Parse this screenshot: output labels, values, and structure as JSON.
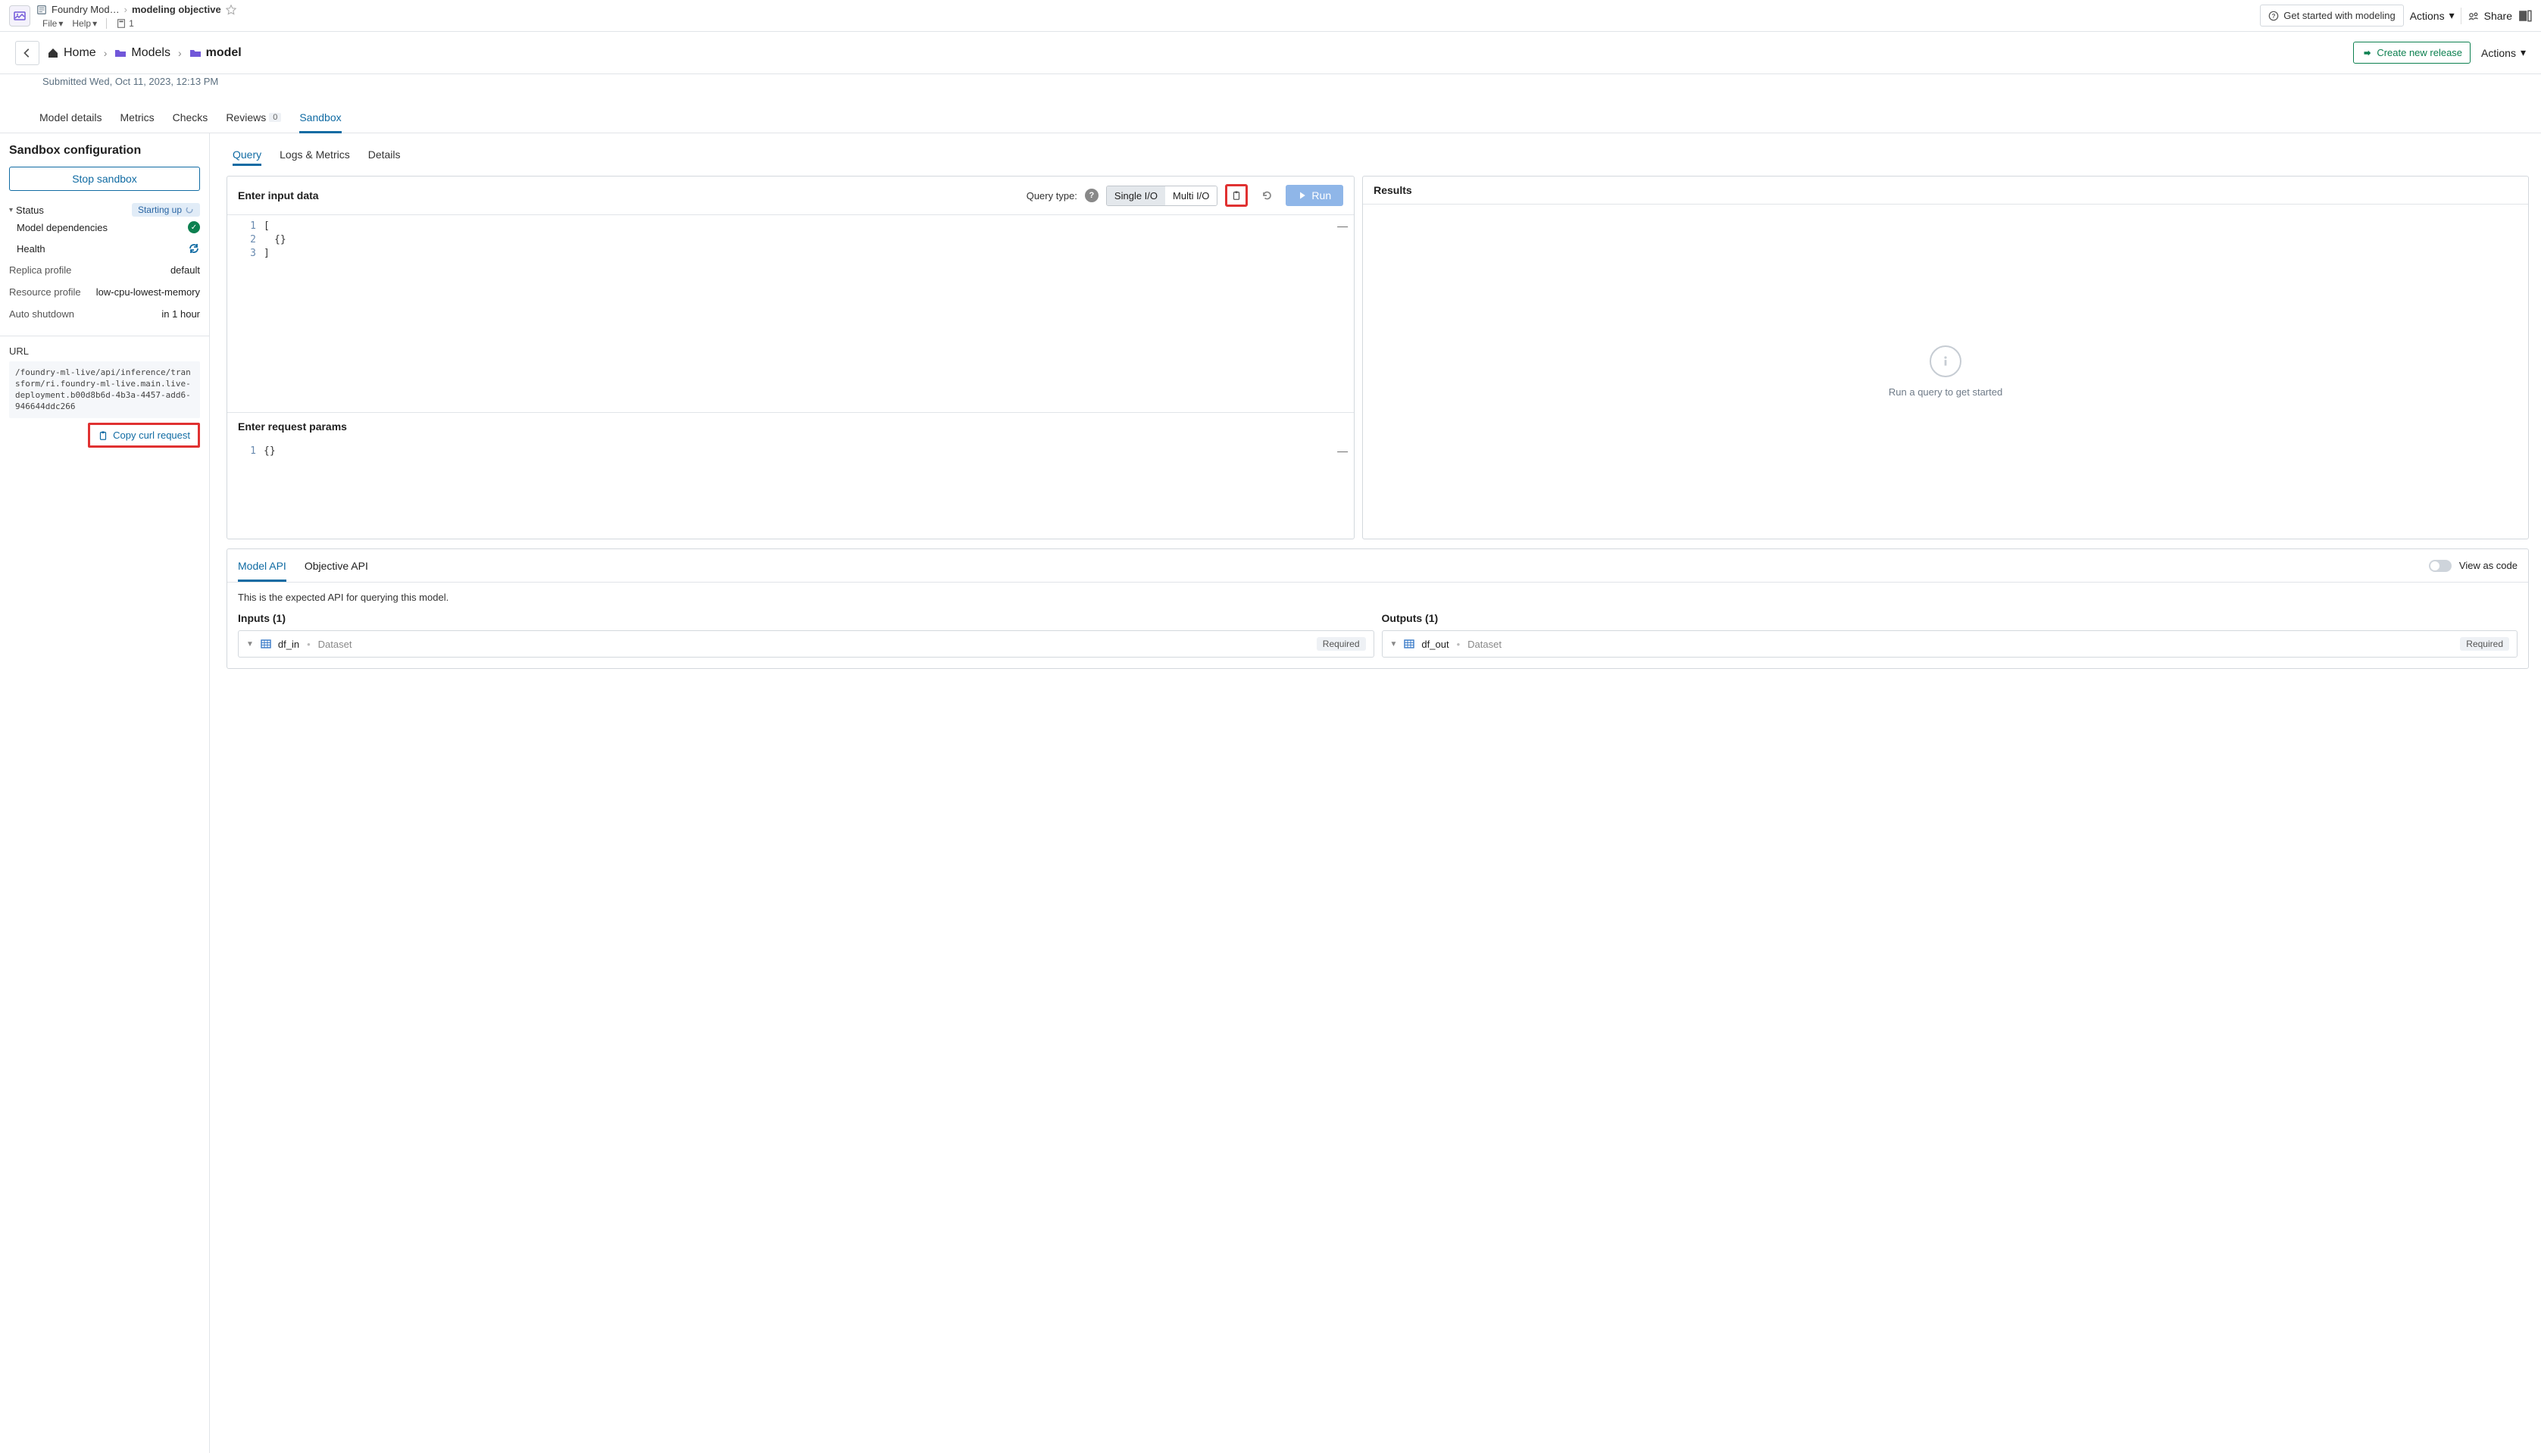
{
  "topbar": {
    "crumb_module": "Foundry Mod…",
    "crumb_page": "modeling objective",
    "menu_file": "File",
    "menu_help": "Help",
    "users_count": "1",
    "get_started": "Get started with modeling",
    "actions": "Actions",
    "share": "Share"
  },
  "nav": {
    "home": "Home",
    "models": "Models",
    "model": "model",
    "submitted": "Submitted Wed, Oct 11, 2023, 12:13 PM",
    "release": "Create new release",
    "actions": "Actions"
  },
  "tabs": {
    "model_details": "Model details",
    "metrics": "Metrics",
    "checks": "Checks",
    "reviews": "Reviews",
    "reviews_count": "0",
    "sandbox": "Sandbox"
  },
  "sidebar": {
    "title": "Sandbox configuration",
    "stop": "Stop sandbox",
    "status_label": "Status",
    "starting_up": "Starting up",
    "dependencies": "Model dependencies",
    "health": "Health",
    "replica_profile_k": "Replica profile",
    "replica_profile_v": "default",
    "resource_profile_k": "Resource profile",
    "resource_profile_v": "low-cpu-lowest-memory",
    "auto_shutdown_k": "Auto shutdown",
    "auto_shutdown_v": "in 1 hour",
    "url_label": "URL",
    "url_value": "/foundry-ml-live/api/inference/transform/ri.foundry-ml-live.main.live-deployment.b00d8b6d-4b3a-4457-add6-946644ddc266",
    "copy_curl": "Copy curl request"
  },
  "content_tabs": {
    "query": "Query",
    "logs": "Logs & Metrics",
    "details": "Details"
  },
  "query_panel": {
    "enter_input": "Enter input data",
    "query_type_label": "Query type:",
    "single_io": "Single I/O",
    "multi_io": "Multi I/O",
    "run": "Run",
    "code_lines": [
      "1",
      "2",
      "3"
    ],
    "code_body_1": "[",
    "code_body_2": "{}",
    "code_body_3": "]",
    "enter_params": "Enter request params",
    "params_lines": [
      "1"
    ],
    "params_body_1": "{}"
  },
  "results_panel": {
    "title": "Results",
    "empty": "Run a query to get started"
  },
  "api": {
    "model_api": "Model API",
    "objective_api": "Objective API",
    "view_as_code": "View as code",
    "description": "This is the expected API for querying this model.",
    "inputs_title": "Inputs (1)",
    "outputs_title": "Outputs (1)",
    "input_name": "df_in",
    "output_name": "df_out",
    "dataset_type": "Dataset",
    "required": "Required"
  }
}
